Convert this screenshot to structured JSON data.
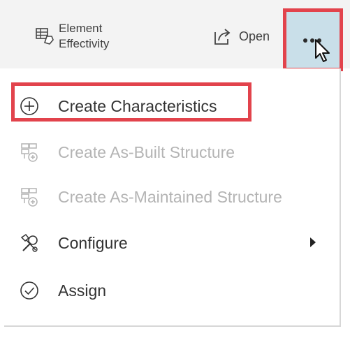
{
  "toolbar": {
    "element_effectivity": {
      "line1": "Element",
      "line2": "Effectivity",
      "icon": "element-effectivity-icon"
    },
    "open": {
      "label": "Open",
      "icon": "open-external-icon"
    },
    "more": {
      "icon": "more-options-icon"
    }
  },
  "menu": {
    "items": [
      {
        "label": "Create Characteristics",
        "icon": "plus-circle-icon",
        "enabled": true,
        "highlighted": true
      },
      {
        "label": "Create As-Built Structure",
        "icon": "structure-add-icon",
        "enabled": false
      },
      {
        "label": "Create As-Maintained Structure",
        "icon": "structure-add-icon",
        "enabled": false
      },
      {
        "label": "Configure",
        "icon": "configure-icon",
        "enabled": true,
        "has_submenu": true
      },
      {
        "label": "Assign",
        "icon": "check-circle-icon",
        "enabled": true
      }
    ]
  },
  "colors": {
    "highlight": "#e2434c",
    "selected_button_bg": "#c9dfe9",
    "disabled_text": "#b4b4b4"
  }
}
